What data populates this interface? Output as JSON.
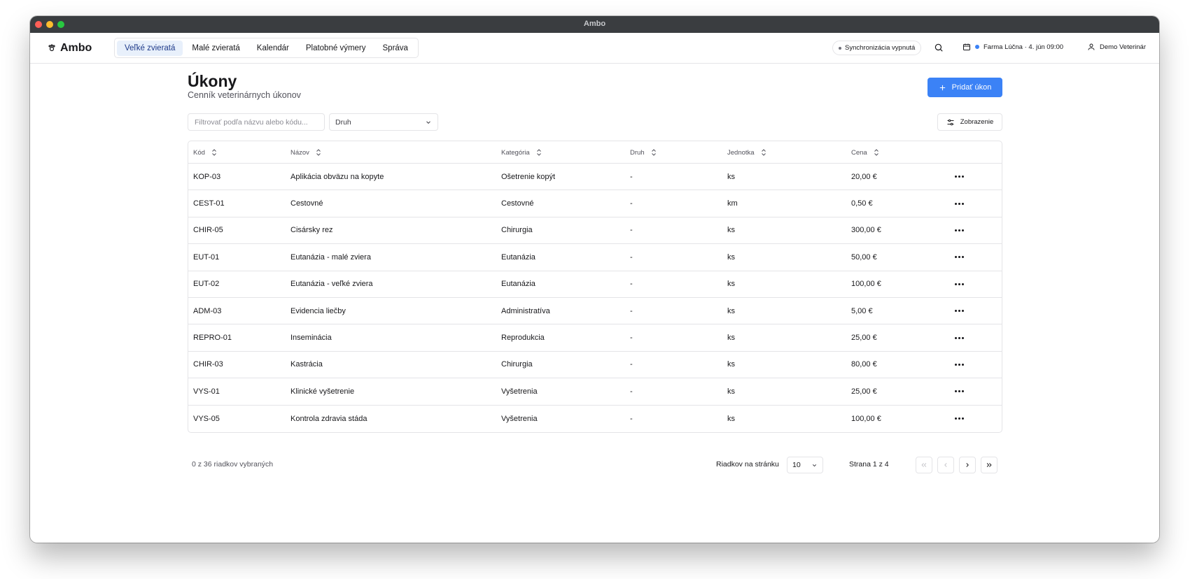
{
  "window": {
    "title": "Ambo"
  },
  "app": {
    "name": "Ambo"
  },
  "nav": {
    "items": [
      {
        "label": "Veľké zvieratá",
        "active": true
      },
      {
        "label": "Malé zvieratá",
        "active": false
      },
      {
        "label": "Kalendár",
        "active": false
      },
      {
        "label": "Platobné výmery",
        "active": false
      },
      {
        "label": "Správa",
        "active": false
      }
    ],
    "sync_label": "Synchronizácia vypnutá",
    "farm_label": "Farma Lúčna · 4. jún 09:00",
    "user_label": "Demo Veterinár"
  },
  "page": {
    "title": "Úkony",
    "subtitle": "Cenník veterinárnych úkonov",
    "add_button": "Pridať úkon"
  },
  "filters": {
    "search_placeholder": "Filtrovať podľa názvu alebo kódu...",
    "species_select": "Druh",
    "view_button": "Zobrazenie"
  },
  "table": {
    "headers": [
      "Kód",
      "Názov",
      "Kategória",
      "Druh",
      "Jednotka",
      "Cena"
    ],
    "rows": [
      {
        "code": "KOP-03",
        "name": "Aplikácia obväzu na kopyte",
        "category": "Ošetrenie kopýt",
        "species": "-",
        "unit": "ks",
        "price": "20,00 €"
      },
      {
        "code": "CEST-01",
        "name": "Cestovné",
        "category": "Cestovné",
        "species": "-",
        "unit": "km",
        "price": "0,50 €"
      },
      {
        "code": "CHIR-05",
        "name": "Cisársky rez",
        "category": "Chirurgia",
        "species": "-",
        "unit": "ks",
        "price": "300,00 €"
      },
      {
        "code": "EUT-01",
        "name": "Eutanázia - malé zviera",
        "category": "Eutanázia",
        "species": "-",
        "unit": "ks",
        "price": "50,00 €"
      },
      {
        "code": "EUT-02",
        "name": "Eutanázia - veľké zviera",
        "category": "Eutanázia",
        "species": "-",
        "unit": "ks",
        "price": "100,00 €"
      },
      {
        "code": "ADM-03",
        "name": "Evidencia liečby",
        "category": "Administratíva",
        "species": "-",
        "unit": "ks",
        "price": "5,00 €"
      },
      {
        "code": "REPRO-01",
        "name": "Inseminácia",
        "category": "Reprodukcia",
        "species": "-",
        "unit": "ks",
        "price": "25,00 €"
      },
      {
        "code": "CHIR-03",
        "name": "Kastrácia",
        "category": "Chirurgia",
        "species": "-",
        "unit": "ks",
        "price": "80,00 €"
      },
      {
        "code": "VYS-01",
        "name": "Klinické vyšetrenie",
        "category": "Vyšetrenia",
        "species": "-",
        "unit": "ks",
        "price": "25,00 €"
      },
      {
        "code": "VYS-05",
        "name": "Kontrola zdravia stáda",
        "category": "Vyšetrenia",
        "species": "-",
        "unit": "ks",
        "price": "100,00 €"
      }
    ]
  },
  "footer": {
    "selected_text": "0 z 36 riadkov vybraných",
    "rows_per_page_label": "Riadkov na stránku",
    "rows_per_page_value": "10",
    "page_info": "Strana 1 z 4"
  },
  "colors": {
    "accent": "#3b82f6",
    "active_nav_bg": "#e8f0fb",
    "border": "#e4e4e7"
  }
}
